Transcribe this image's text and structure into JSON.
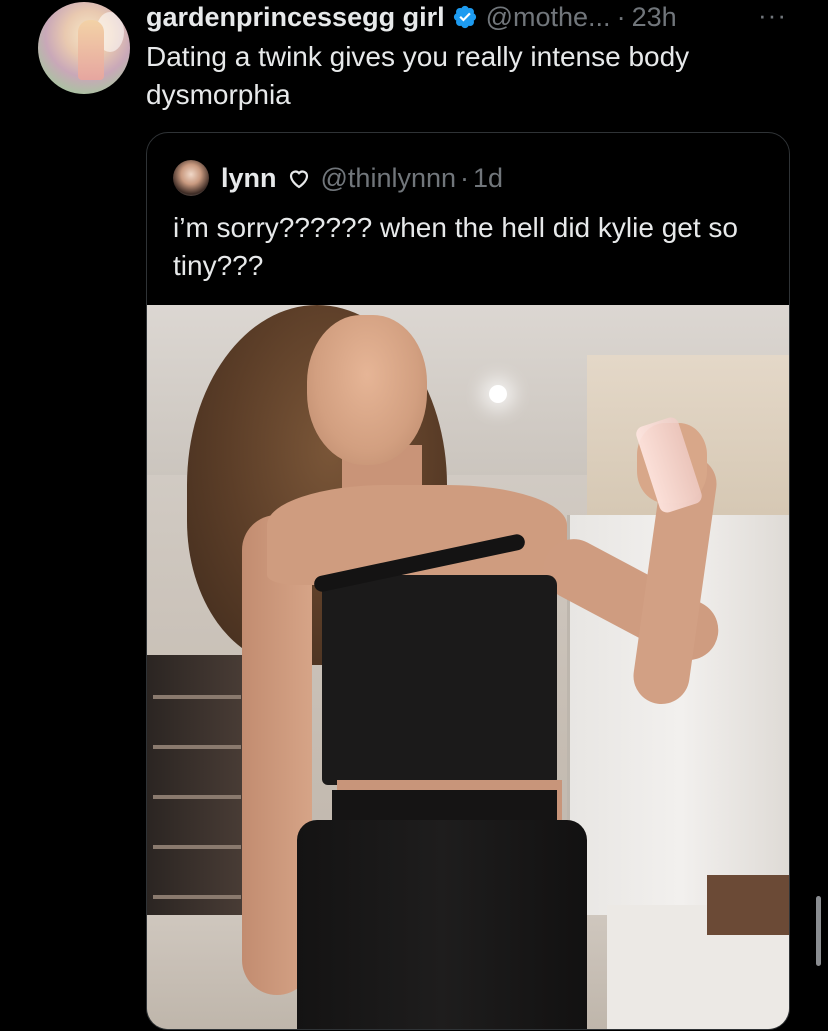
{
  "tweet": {
    "display_name": "gardenprincessegg girl",
    "verified": true,
    "handle": "@mothe...",
    "separator": "·",
    "time": "23h",
    "more": "···",
    "text": "Dating a twink gives you really intense body dysmorphia"
  },
  "quote": {
    "display_name": "lynn",
    "name_icon": "heart-outline-icon",
    "handle": "@thinlynnn",
    "separator": "·",
    "time": "1d",
    "text": "i’m sorry?????? when the hell did kylie get so tiny???"
  },
  "colors": {
    "background": "#000000",
    "text_primary": "#e7e9ea",
    "text_secondary": "#71767b",
    "verified_blue": "#1d9bf0",
    "border": "#2f3336"
  }
}
